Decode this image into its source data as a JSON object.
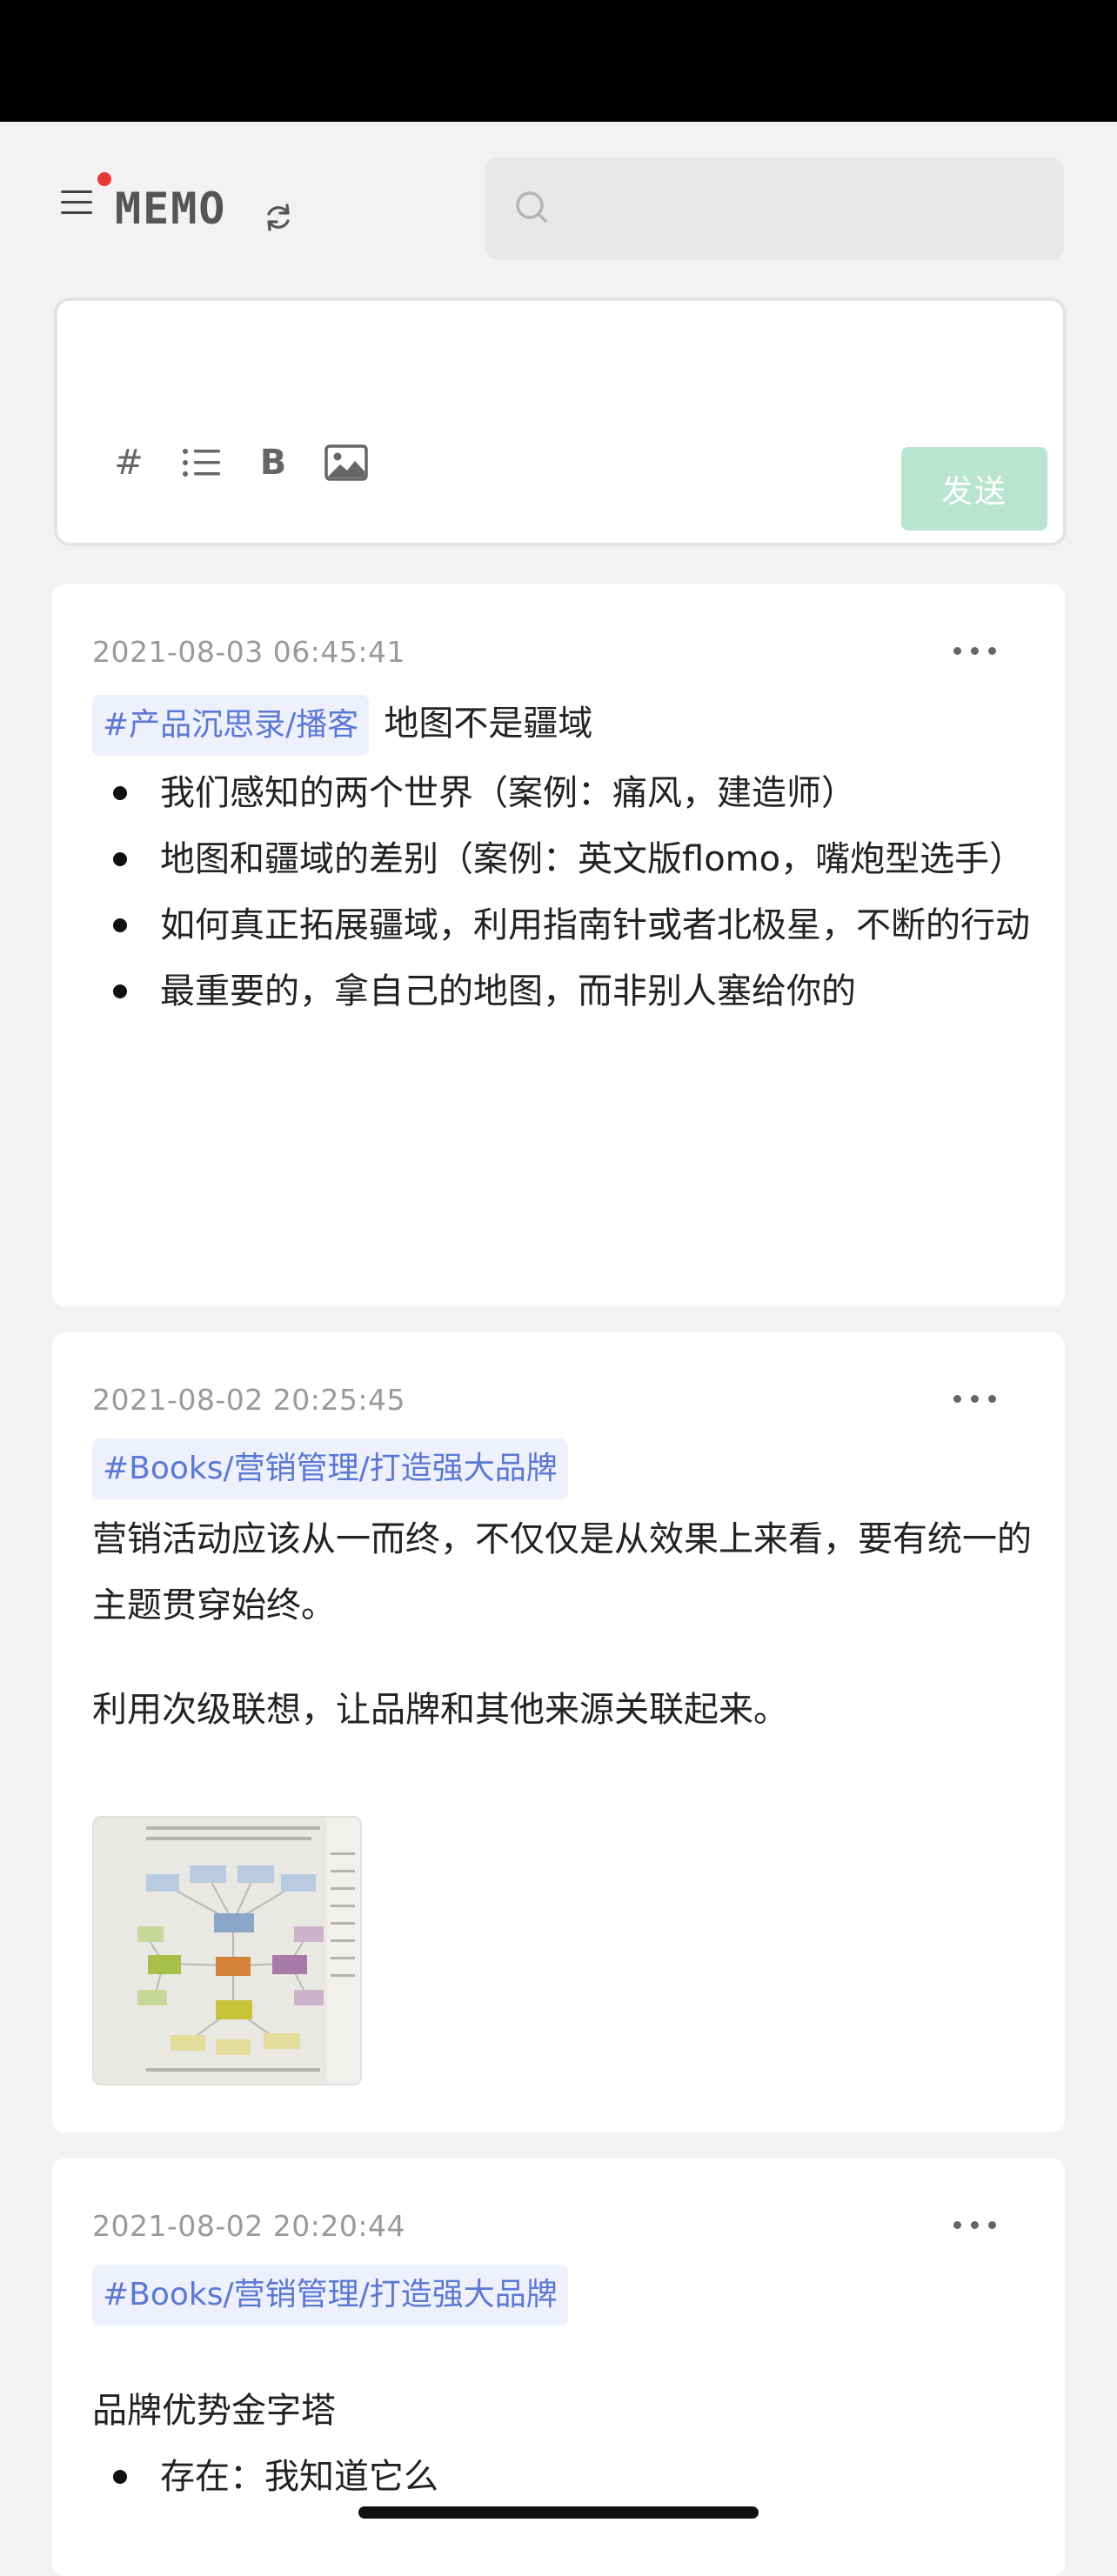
{
  "header": {
    "title": "MEMO",
    "search_placeholder": ""
  },
  "editor": {
    "placeholder": "",
    "toolbar": {
      "hash": "#",
      "bold": "B"
    },
    "send_label": "发送"
  },
  "memos": [
    {
      "date": "2021-08-03 06:45:41",
      "tag": "#产品沉思录/播客",
      "title": "地图不是疆域",
      "bullets": [
        "我们感知的两个世界（案例：痛风，建造师）",
        "地图和疆域的差别（案例：英文版flomo，嘴炮型选手）",
        "如何真正拓展疆域，利用指南针或者北极星，不断的行动",
        "最重要的，拿自己的地图，而非别人塞给你的"
      ]
    },
    {
      "date": "2021-08-02 20:25:45",
      "tag": "#Books/营销管理/打造强大品牌",
      "paragraphs": [
        "营销活动应该从一而终，不仅仅是从效果上来看，要有统一的主题贯穿始终。",
        "利用次级联想，让品牌和其他来源关联起来。"
      ]
    },
    {
      "date": "2021-08-02 20:20:44",
      "tag": "#Books/营销管理/打造强大品牌",
      "heading": "品牌优势金字塔",
      "bullets": [
        "存在：我知道它么"
      ]
    }
  ],
  "colors": {
    "accent": "#b9e4d1",
    "tag_text": "#5b78d4",
    "tag_bg": "#eef0fb",
    "notification_dot": "#e53935"
  },
  "icons": [
    "menu-icon",
    "sync-icon",
    "search-icon",
    "list-icon",
    "image-icon",
    "more-icon"
  ]
}
